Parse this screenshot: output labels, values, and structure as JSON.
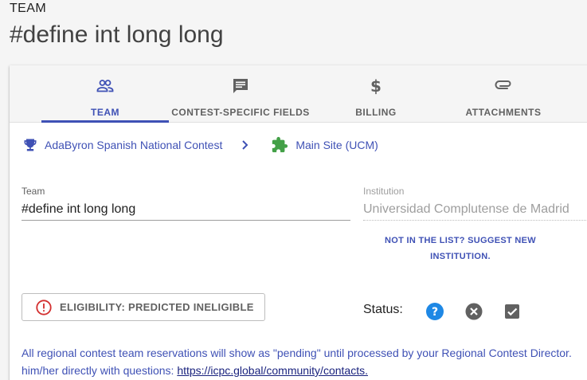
{
  "header": {
    "kicker": "TEAM",
    "title": "#define int long long"
  },
  "tabs": [
    {
      "label": "TEAM",
      "icon": "people-icon",
      "active": true
    },
    {
      "label": "CONTEST-SPECIFIC FIELDS",
      "icon": "comment-icon",
      "active": false
    },
    {
      "label": "BILLING",
      "icon": "dollar-icon",
      "active": false
    },
    {
      "label": "ATTACHMENTS",
      "icon": "paperclip-icon",
      "active": false
    }
  ],
  "breadcrumb": {
    "contest": "AdaByron Spanish National Contest",
    "site": "Main Site (UCM)"
  },
  "form": {
    "team_label": "Team",
    "team_value": "#define int long long",
    "institution_label": "Institution",
    "institution_value": "Universidad Complutense de Madrid",
    "suggest_line1": "NOT IN THE LIST? SUGGEST NEW",
    "suggest_line2": "INSTITUTION."
  },
  "eligibility": {
    "label": "ELIGIBILITY: PREDICTED INELIGIBLE"
  },
  "status": {
    "label": "Status:"
  },
  "notice": {
    "text1": "All regional contest team reservations will show as \"pending\" until processed by your Regional Contest Director.",
    "text2": "him/her directly with questions: ",
    "link": "https://icpc.global/community/contacts."
  },
  "colors": {
    "primary": "#3f51b5",
    "error": "#d32f2f",
    "help": "#1e88e5",
    "trophy": "#3f51b5",
    "puzzle": "#43a047"
  }
}
